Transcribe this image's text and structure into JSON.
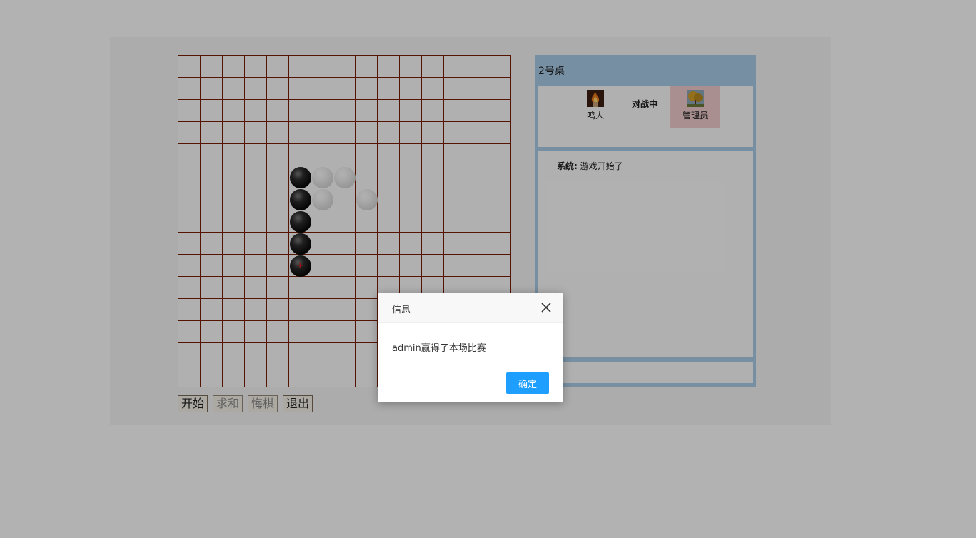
{
  "controls": {
    "start_label": "开始",
    "draw_label": "求和",
    "undo_label": "悔棋",
    "exit_label": "退出"
  },
  "table": {
    "title": "2号桌",
    "status": "对战中",
    "player_left": {
      "name": "鸣人",
      "avatar_icon": "fire-avatar-icon"
    },
    "player_right": {
      "name": "管理员",
      "avatar_icon": "tree-avatar-icon",
      "highlight_color": "#f2cdcd"
    }
  },
  "chat": {
    "messages": [
      {
        "sender": "系统:",
        "text": "游戏开始了"
      }
    ],
    "input_value": ""
  },
  "board": {
    "size": 15,
    "stones": [
      {
        "row": 5,
        "col": 5,
        "color": "black"
      },
      {
        "row": 5,
        "col": 6,
        "color": "white"
      },
      {
        "row": 5,
        "col": 7,
        "color": "white"
      },
      {
        "row": 6,
        "col": 5,
        "color": "black"
      },
      {
        "row": 6,
        "col": 6,
        "color": "white"
      },
      {
        "row": 6,
        "col": 8,
        "color": "white"
      },
      {
        "row": 7,
        "col": 5,
        "color": "black"
      },
      {
        "row": 8,
        "col": 5,
        "color": "black"
      },
      {
        "row": 9,
        "col": 5,
        "color": "black",
        "last": true
      }
    ],
    "last_move_marker": "+"
  },
  "dialog": {
    "title": "信息",
    "message": "admin赢得了本场比赛",
    "ok_label": "确定",
    "close_icon": "close-icon"
  },
  "colors": {
    "board_line": "#7a1e00",
    "panel_border": "#aacdea",
    "primary_button": "#1e9fff",
    "overlay": "rgba(0,0,0,0.3)"
  }
}
